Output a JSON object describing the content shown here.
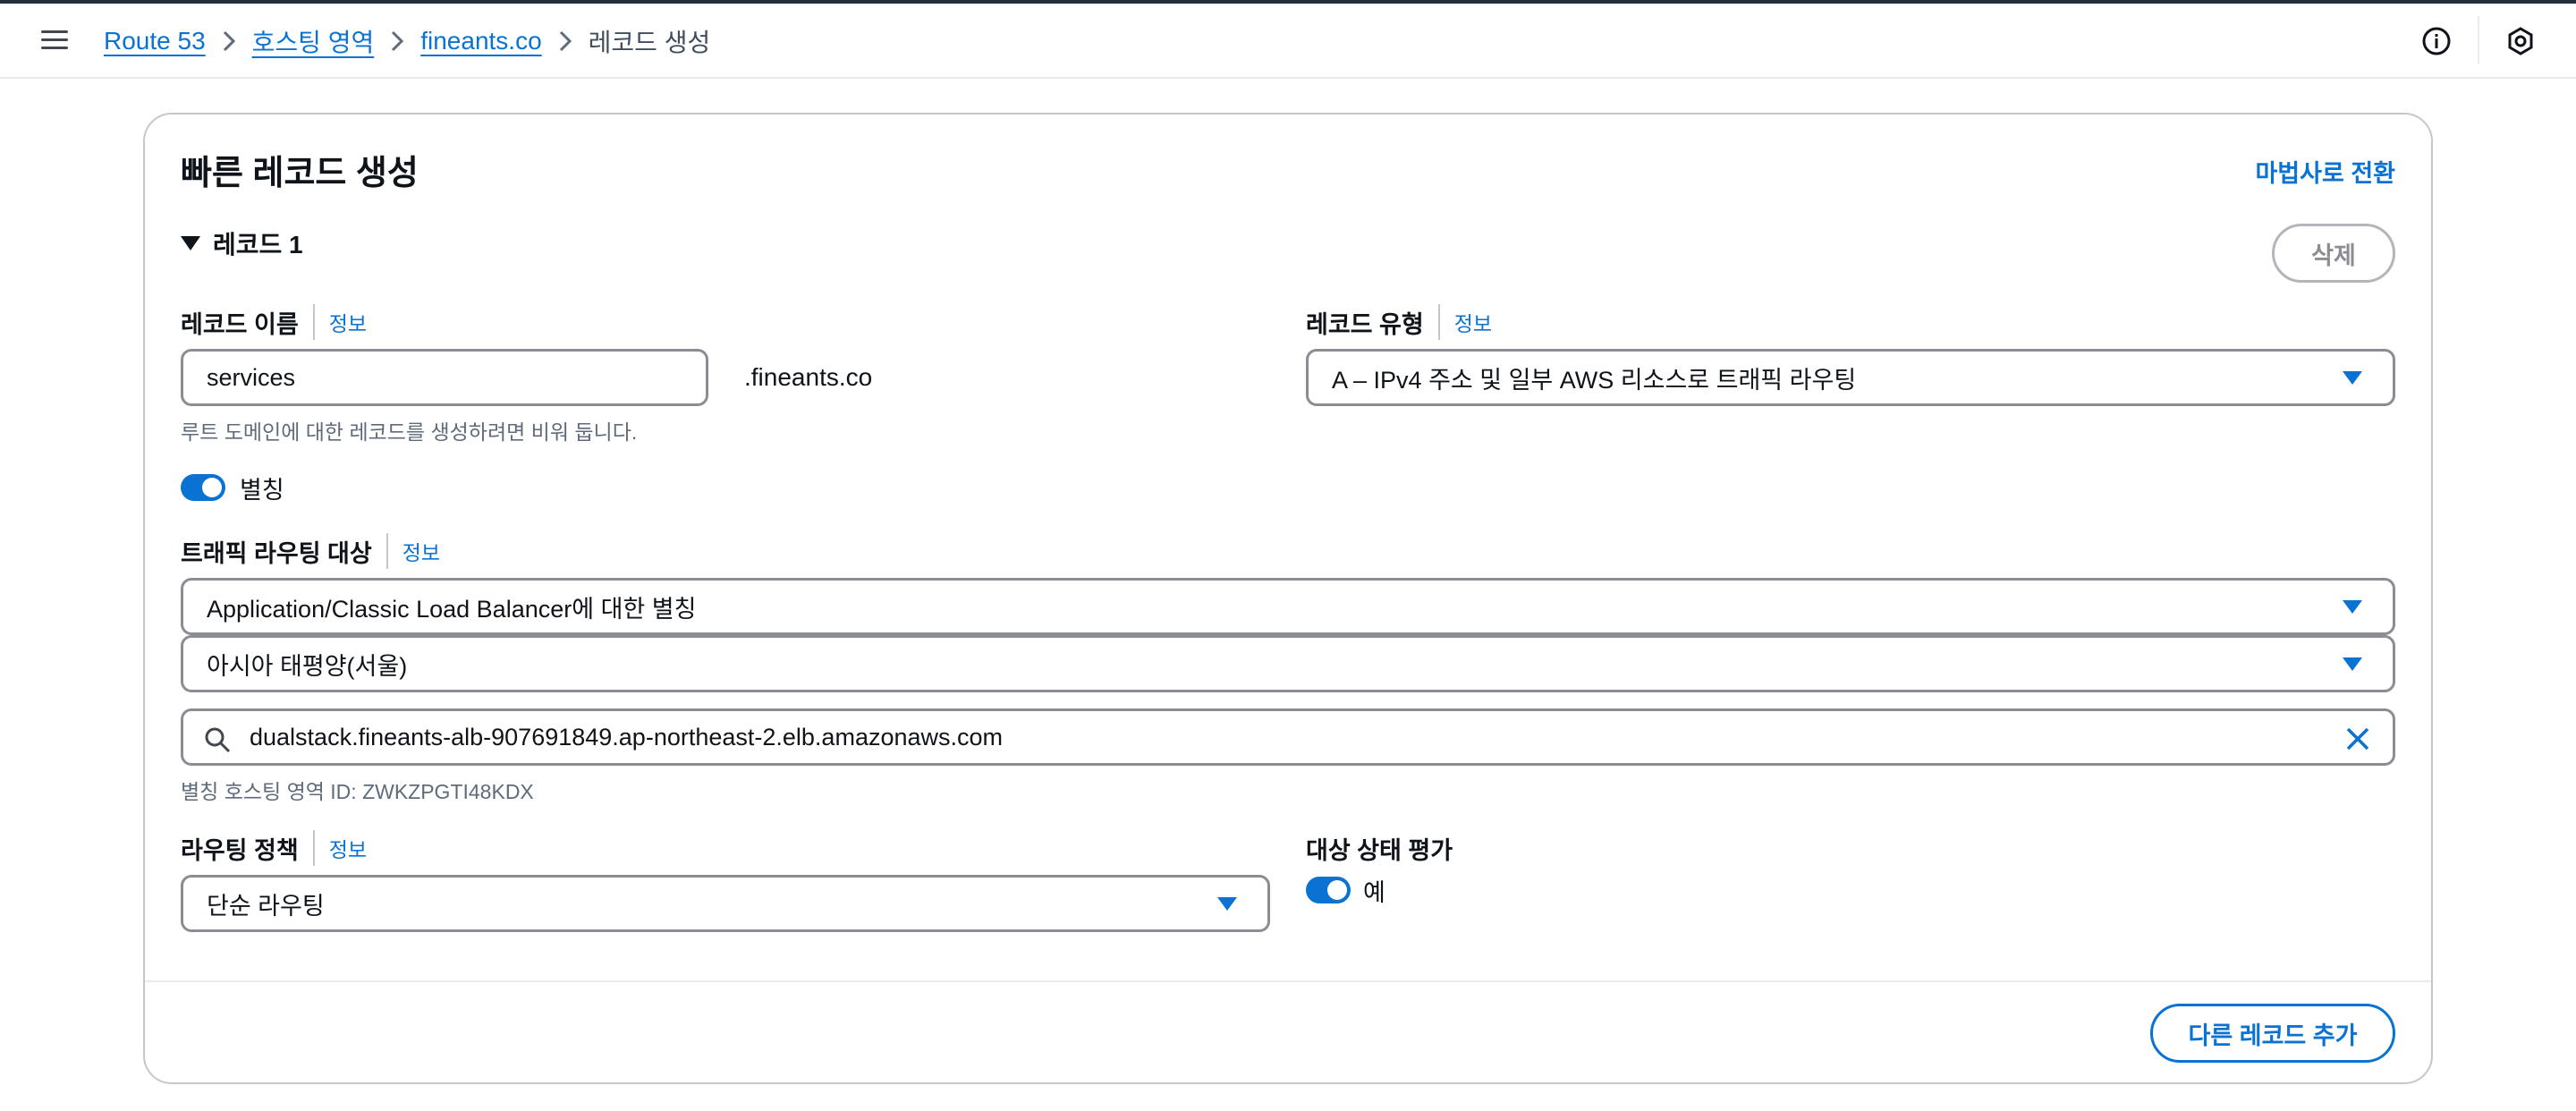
{
  "breadcrumbs": {
    "items": [
      "Route 53",
      "호스팅 영역",
      "fineants.co"
    ],
    "current": "레코드 생성"
  },
  "card": {
    "title": "빠른 레코드 생성",
    "wizard_link": "마법사로 전환",
    "record_section": "레코드 1",
    "delete_label": "삭제",
    "add_record_label": "다른 레코드 추가"
  },
  "info_label": "정보",
  "record_name": {
    "label": "레코드 이름",
    "value": "services",
    "suffix": ".fineants.co",
    "hint": "루트 도메인에 대한 레코드를 생성하려면 비워 둡니다."
  },
  "record_type": {
    "label": "레코드 유형",
    "value": "A – IPv4 주소 및 일부 AWS 리소스로 트래픽 라우팅"
  },
  "alias": {
    "label": "별칭",
    "enabled": true
  },
  "traffic_target": {
    "label": "트래픽 라우팅 대상",
    "endpoint_type": "Application/Classic Load Balancer에 대한 별칭",
    "region": "아시아 태평양(서울)",
    "search_value": "dualstack.fineants-alb-907691849.ap-northeast-2.elb.amazonaws.com",
    "hosted_zone_id": "별칭 호스팅 영역 ID: ZWKZPGTI48KDX"
  },
  "routing_policy": {
    "label": "라우팅 정책",
    "value": "단순 라우팅"
  },
  "health": {
    "label": "대상 상태 평가",
    "toggle_label": "예",
    "enabled": true
  },
  "colors": {
    "accent": "#0972d3",
    "border": "#8c8c94",
    "text": "#0f141a"
  },
  "icons": [
    "menu-icon",
    "chevron-right-icon",
    "info-icon",
    "settings-icon",
    "search-icon",
    "close-icon",
    "caret-down-icon"
  ]
}
